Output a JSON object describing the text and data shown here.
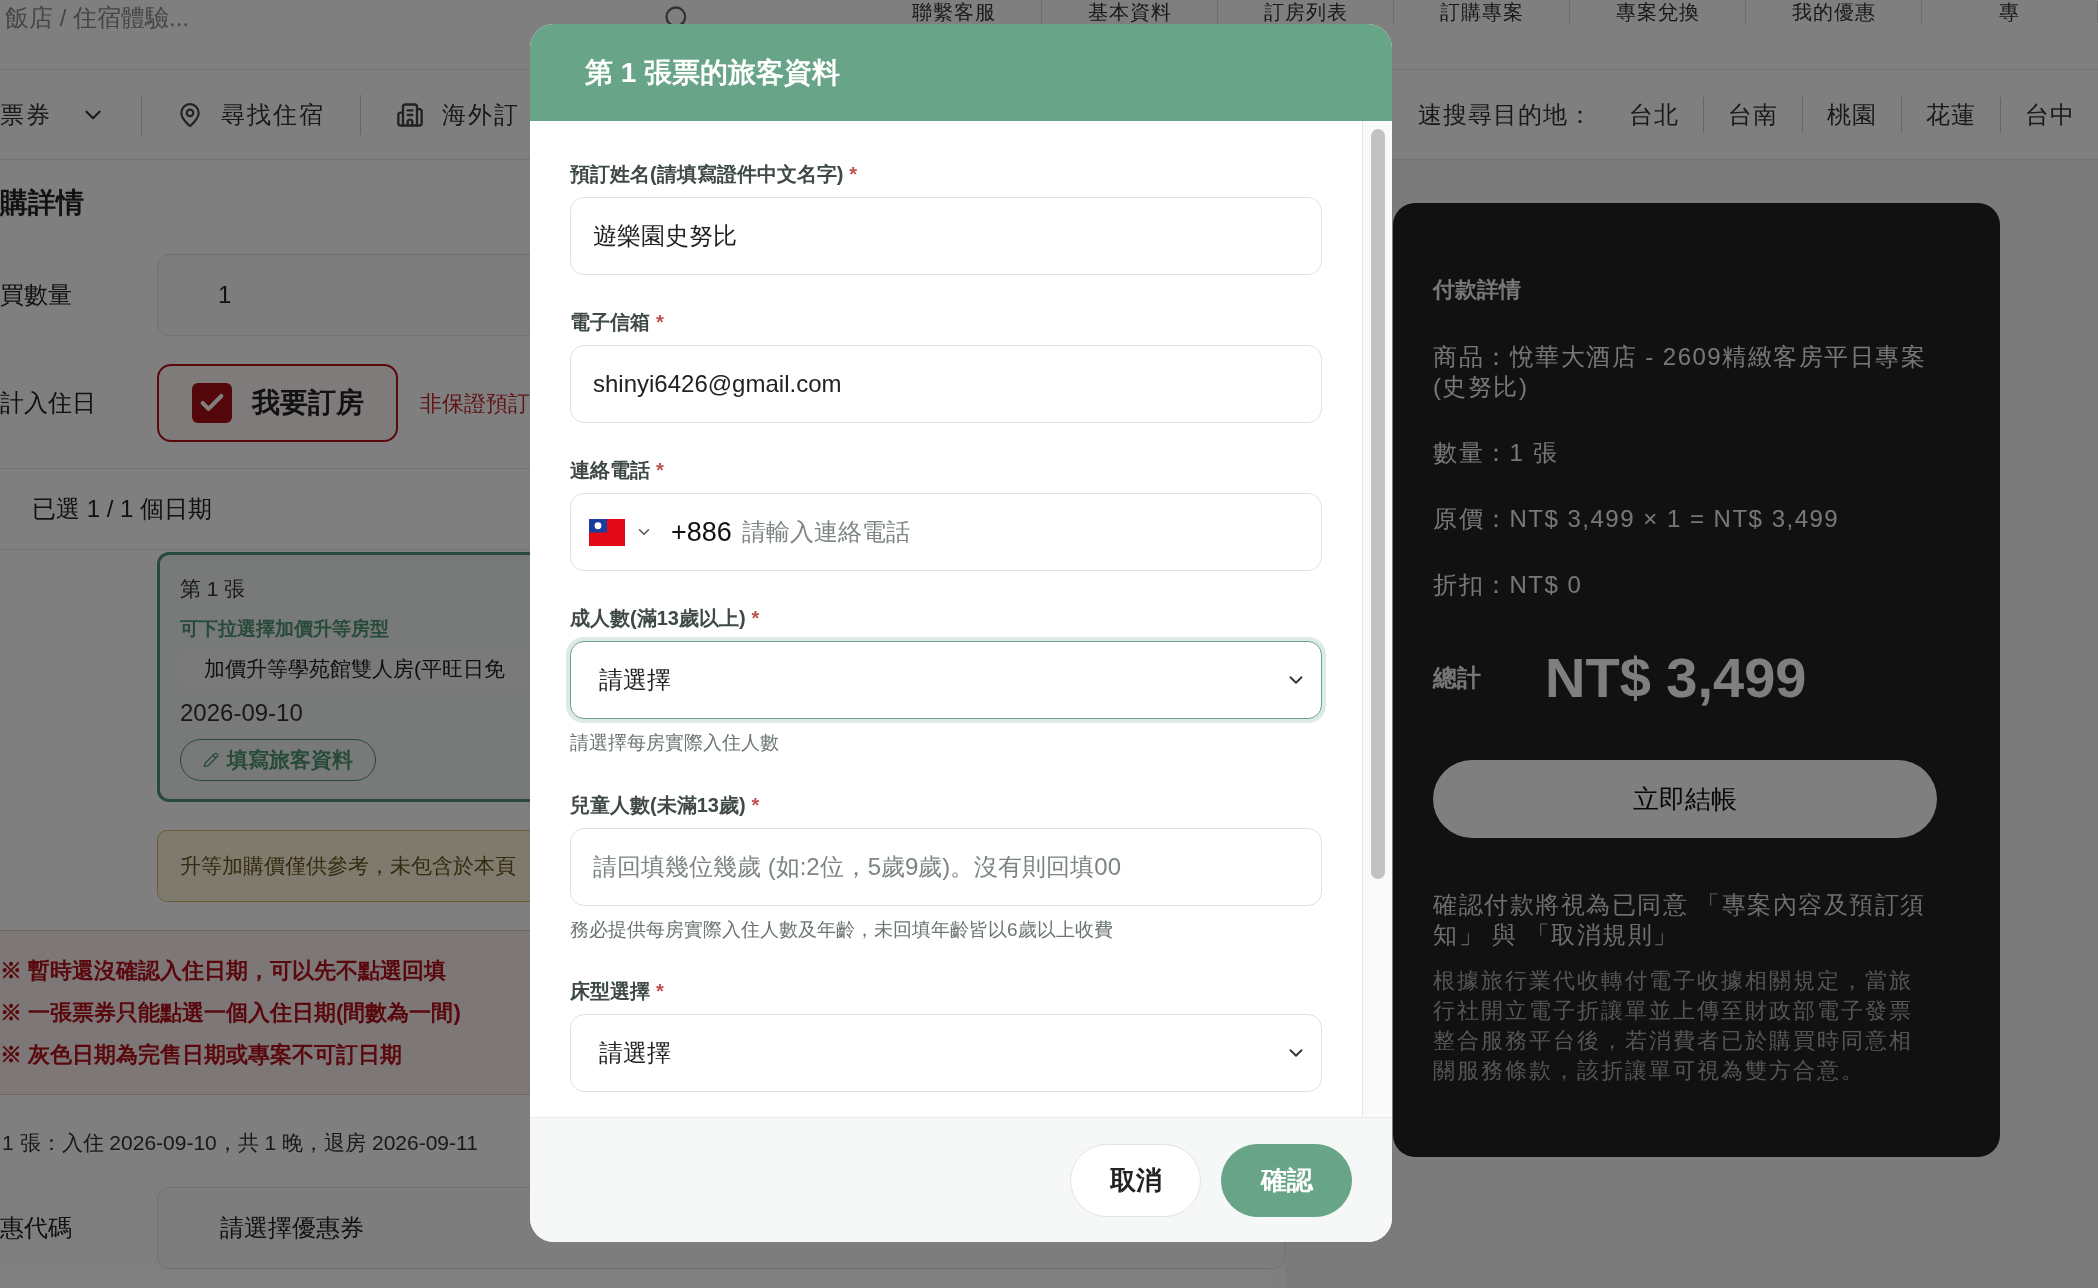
{
  "top_nav": {
    "search_placeholder": "飯店 / 住宿體驗...",
    "links": [
      "聯繫客服",
      "基本資料",
      "訂房列表",
      "訂購專案",
      "專案兌換",
      "我的優惠",
      "專"
    ]
  },
  "category_nav": {
    "items": [
      {
        "kind": "dropdown",
        "label": "票券"
      },
      {
        "kind": "location",
        "label": "尋找住宿"
      },
      {
        "kind": "overseas",
        "label": "海外訂"
      }
    ],
    "quick_search_label": "速搜尋目的地：",
    "destinations": [
      "台北",
      "台南",
      "桃園",
      "花蓮",
      "台中"
    ]
  },
  "order": {
    "title": "購詳情",
    "quantity_label": "買數量",
    "quantity_value": "1",
    "checkin_label": "計入住日",
    "book_room": {
      "label": "我要訂房",
      "checked": true
    },
    "non_guarantee_note": "非保證預訂",
    "selected_dates": "已選 1 / 1 個日期",
    "ticket": {
      "title": "第 1 張",
      "upgrade_label": "可下拉選擇加價升等房型",
      "upgrade_value": "加價升等學苑館雙人房(平旺日免",
      "date": "2026-09-10",
      "fill_button": "填寫旅客資料"
    },
    "upgrade_note": "升等加購價僅供參考，未包含於本頁",
    "notices": [
      "※ 暫時還沒確認入住日期，可以先不點選回填",
      "※ 一張票券只能點選一個入住日期(間數為一間)",
      "※ 灰色日期為完售日期或專案不可訂日期"
    ],
    "summary": "1 張：入住 2026-09-10，共 1 晚，退房 2026-09-11",
    "coupon_label": "惠代碼",
    "coupon_value": "請選擇優惠券"
  },
  "payment": {
    "title": "付款詳情",
    "lines": [
      "商品：悅華大酒店 - 2609精緻客房平日專案 (史努比)",
      "數量：1 張",
      "原價：NT$ 3,499 × 1 = NT$ 3,499",
      "折扣：NT$ 0"
    ],
    "total_label": "總計",
    "total": "NT$ 3,499",
    "checkout_button": "立即結帳",
    "agreement": "確認付款將視為已同意 「專案內容及預訂須知」 與 「取消規則」",
    "legal": "根據旅行業代收轉付電子收據相關規定，當旅行社開立電子折讓單並上傳至財政部電子發票整合服務平台後，若消費者已於購買時同意相關服務條款，該折讓單可視為雙方合意。"
  },
  "modal": {
    "title": "第 1 張票的旅客資料",
    "fields": [
      {
        "kind": "input",
        "label": "預訂姓名(請填寫證件中文名字)",
        "mark": "*",
        "value": "遊樂園史努比"
      },
      {
        "kind": "input",
        "label": "電子信箱",
        "mark": "*",
        "value": "shinyi6426@gmail.com"
      },
      {
        "kind": "phone",
        "label": "連絡電話",
        "mark": "*",
        "code": "+886",
        "placeholder": "請輸入連絡電話"
      },
      {
        "kind": "select",
        "label": "成人數(滿13歲以上)",
        "mark": "*",
        "value": "請選擇",
        "focused": true,
        "hint": "請選擇每房實際入住人數"
      },
      {
        "kind": "input",
        "label": "兒童人數(未滿13歲)",
        "mark": "*",
        "placeholder": "請回填幾位幾歲 (如:2位，5歲9歲)。沒有則回填00",
        "hint": "務必提供每房實際入住人數及年齡，未回填年齡皆以6歲以上收費"
      },
      {
        "kind": "select",
        "label": "床型選擇",
        "mark": "*",
        "value": "請選擇",
        "focused": false
      }
    ],
    "buttons": [
      {
        "kind": "secondary",
        "label": "取消"
      },
      {
        "kind": "primary",
        "label": "確認"
      }
    ]
  }
}
